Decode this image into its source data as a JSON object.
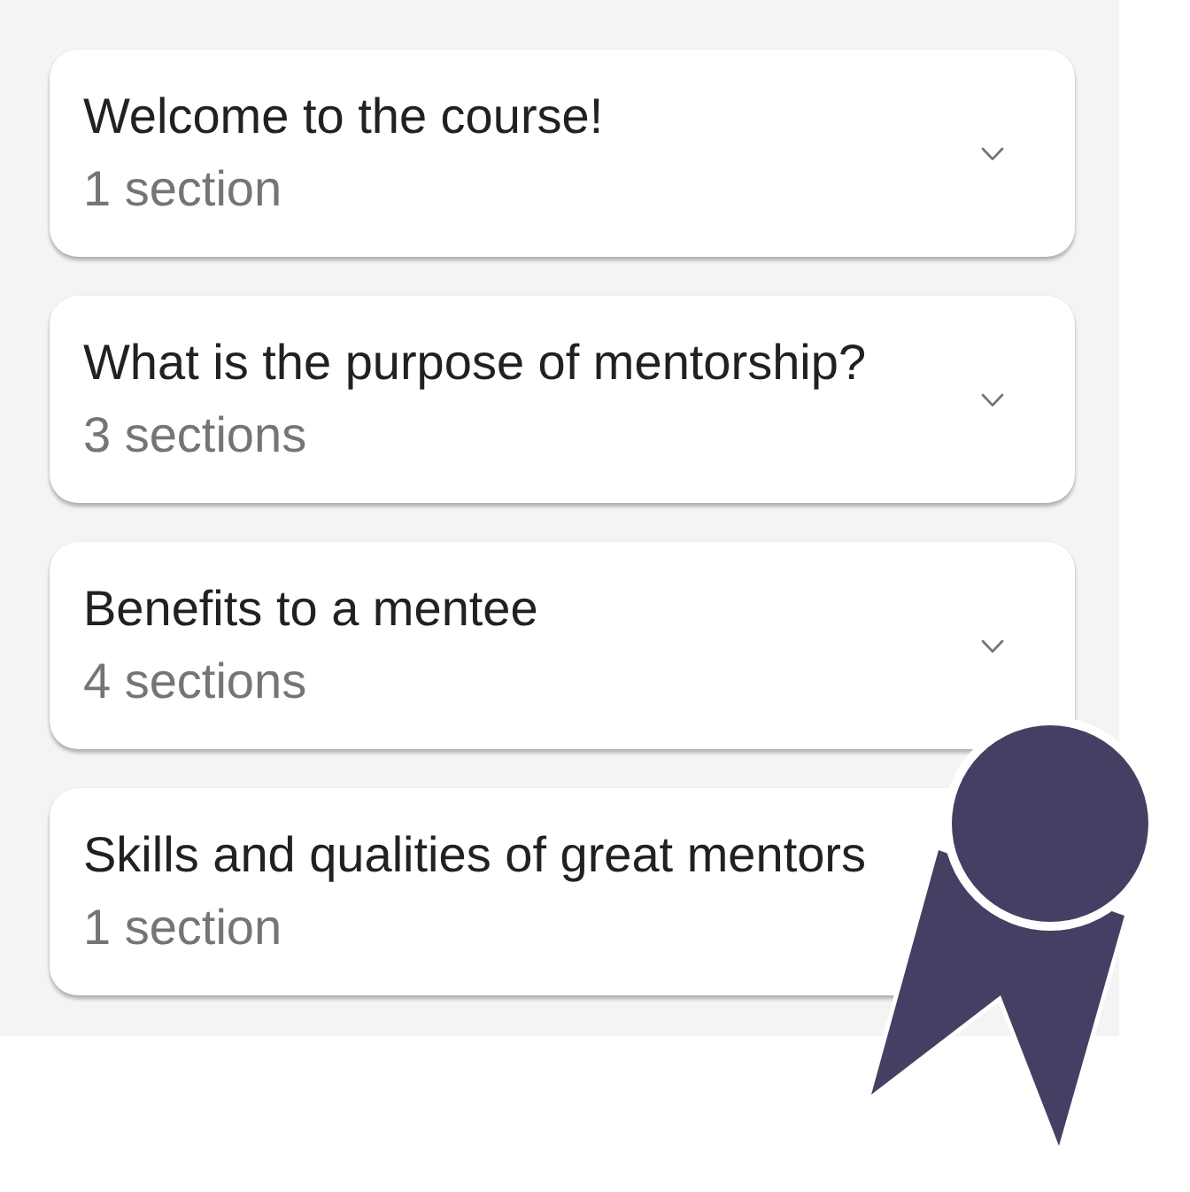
{
  "modules": [
    {
      "title": "Welcome to the course!",
      "sections": "1 section",
      "expanded": false
    },
    {
      "title": "What is the purpose of mentorship?",
      "sections": "3 sections",
      "expanded": false
    },
    {
      "title": "Benefits to a mentee",
      "sections": "4 sections",
      "expanded": false
    },
    {
      "title": "Skills and qualities of great mentors",
      "sections": "1 section"
    }
  ]
}
